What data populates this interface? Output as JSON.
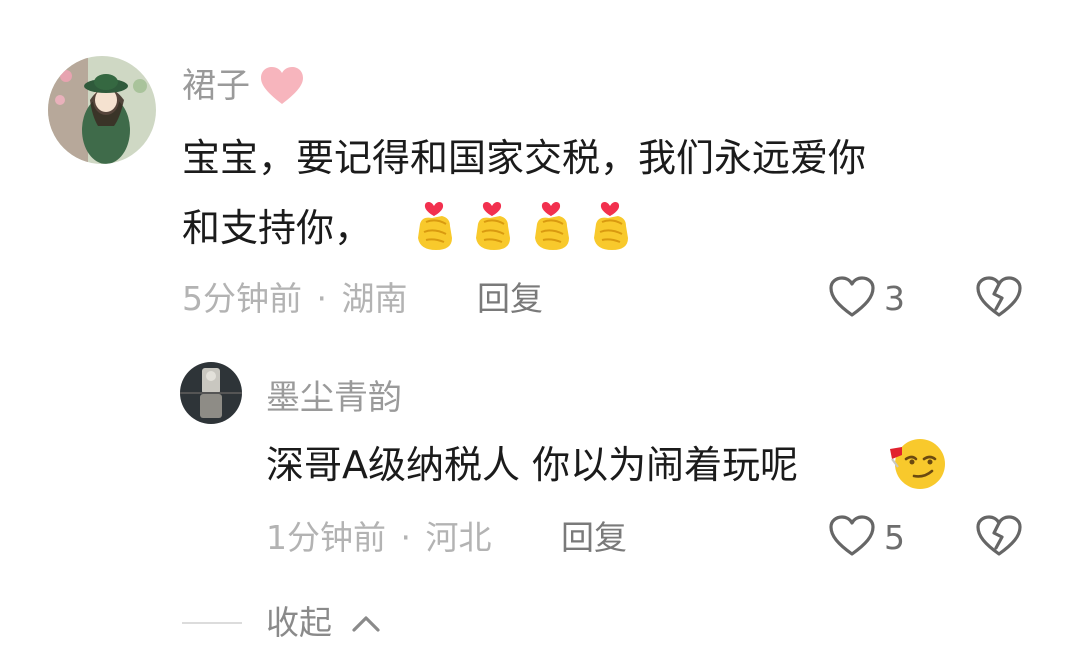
{
  "comments": [
    {
      "username": "裙子",
      "text_line1": "宝宝，要记得和国家交税，我们永远爱你",
      "text_line2": "和支持你，",
      "time": "5分钟前",
      "separator": "·",
      "location": "湖南",
      "reply_label": "回复",
      "like_count": "3",
      "icons": [
        "heart-badge-icon",
        "finger-heart-emoji-icon",
        "like-heart-icon",
        "dislike-broken-heart-icon"
      ]
    }
  ],
  "replies": [
    {
      "username": "墨尘青韵",
      "text": "深哥A级纳税人 你以为闹着玩呢",
      "time": "1分钟前",
      "separator": "·",
      "location": "河北",
      "reply_label": "回复",
      "like_count": "5",
      "icons": [
        "smirk-emoji-icon",
        "like-heart-icon",
        "dislike-broken-heart-icon"
      ]
    }
  ],
  "collapse": {
    "label": "收起",
    "icon": "chevron-up-icon"
  },
  "colors": {
    "username": "#9a9a9a",
    "text": "#1b1b1b",
    "meta": "#b3b3b3",
    "heart_badge": "#f7b5bd"
  }
}
